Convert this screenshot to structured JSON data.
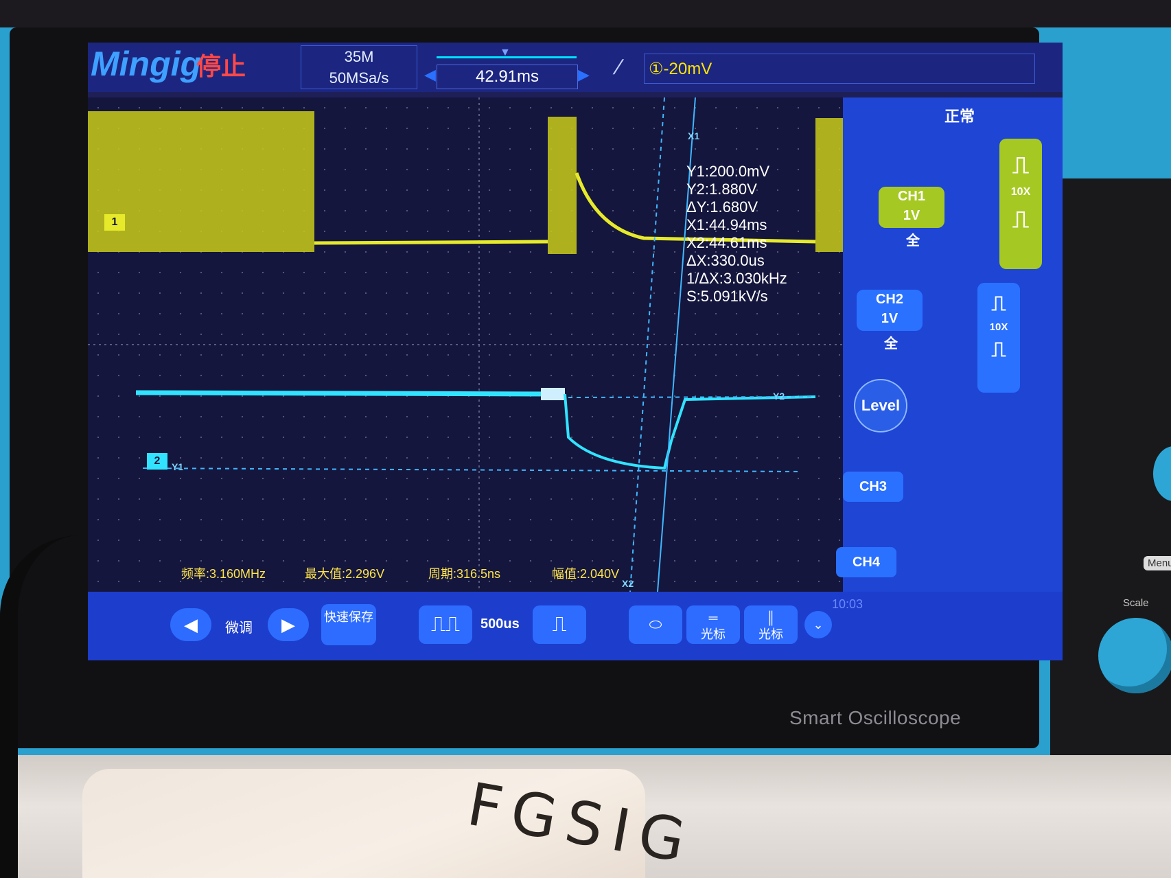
{
  "screen": {
    "brand": "Mingig",
    "run_state": "停止",
    "mem_depth": "35M",
    "sample_rate": "50MSa/s",
    "time_offset": "42.91ms",
    "trigger_level": "①-20mV"
  },
  "cursor_readout": {
    "x1_tag": "X1",
    "x2_tag": "X2",
    "y1_tag": "Y1",
    "y2_tag": "Y2",
    "y1": "Y1:200.0mV",
    "y2": "Y2:1.880V",
    "dy": "ΔY:1.680V",
    "x1": "X1:44.94ms",
    "x2": "X2:44.61ms",
    "dx": "ΔX:330.0us",
    "inv_dx": "1/ΔX:3.030kHz",
    "slope": "S:5.091kV/s"
  },
  "channel_markers": {
    "ch1": "1",
    "ch2": "2"
  },
  "measurements": [
    {
      "text": "频率:3.160MHz"
    },
    {
      "text": "最大值:2.296V"
    },
    {
      "text": "周期:316.5ns"
    },
    {
      "text": "幅值:2.040V"
    }
  ],
  "side_panel": {
    "trigger_mode": "正常",
    "ch1_name": "CH1",
    "ch1_scale": "1V",
    "ch1_bw": "全",
    "ch1_probe": "10X",
    "ch2_name": "CH2",
    "ch2_scale": "1V",
    "ch2_bw": "全",
    "ch2_probe": "10X",
    "level_label": "Level",
    "ch3_label": "CH3",
    "ch4_label": "CH4"
  },
  "bottom_bar": {
    "fine_label": "微调",
    "quick_save": "快速保存",
    "timebase": "500us",
    "cursor_h": "光标",
    "cursor_v": "光标",
    "clock": "10:03"
  },
  "device": {
    "brand_line": "Smart Oscilloscope",
    "scale_label": "Scale",
    "menu_label": "Menu"
  },
  "desk": {
    "bag_marking": "FGSIG"
  },
  "colors": {
    "ch1": "#e6ea2a",
    "ch2": "#31e3ff",
    "screen_bg": "#15163d",
    "panel": "#1e45d4"
  }
}
